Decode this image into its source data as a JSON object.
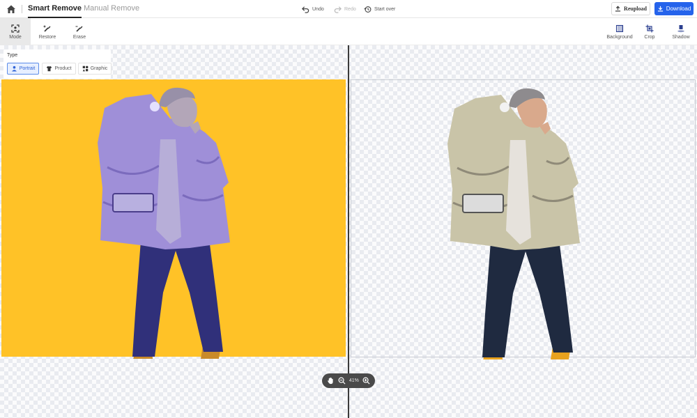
{
  "header": {
    "tabs": [
      {
        "label": "Smart Remove",
        "active": true
      },
      {
        "label": "Manual Remove",
        "active": false
      }
    ],
    "actions": {
      "undo": "Undo",
      "redo": "Redo",
      "start_over": "Start over"
    },
    "reupload_label": "Reupload",
    "download_label": "Download"
  },
  "toolbar": {
    "left_tools": [
      {
        "label": "Mode",
        "icon": "portrait-frame-icon",
        "active": true
      },
      {
        "label": "Restore",
        "icon": "brush-plus-icon",
        "active": false
      },
      {
        "label": "Erase",
        "icon": "brush-minus-icon",
        "active": false
      }
    ],
    "right_tools": [
      {
        "label": "Background",
        "icon": "background-icon"
      },
      {
        "label": "Crop",
        "icon": "crop-icon"
      },
      {
        "label": "Shadow",
        "icon": "shadow-icon"
      }
    ]
  },
  "type_panel": {
    "title": "Type",
    "options": [
      {
        "label": "Portrait",
        "icon": "person-icon",
        "selected": true
      },
      {
        "label": "Product",
        "icon": "shirt-icon",
        "selected": false
      },
      {
        "label": "Graphic",
        "icon": "shapes-icon",
        "selected": false
      }
    ]
  },
  "zoom": {
    "value": "41%"
  },
  "colors": {
    "accent": "#2563eb",
    "original_background": "#ffc227"
  }
}
